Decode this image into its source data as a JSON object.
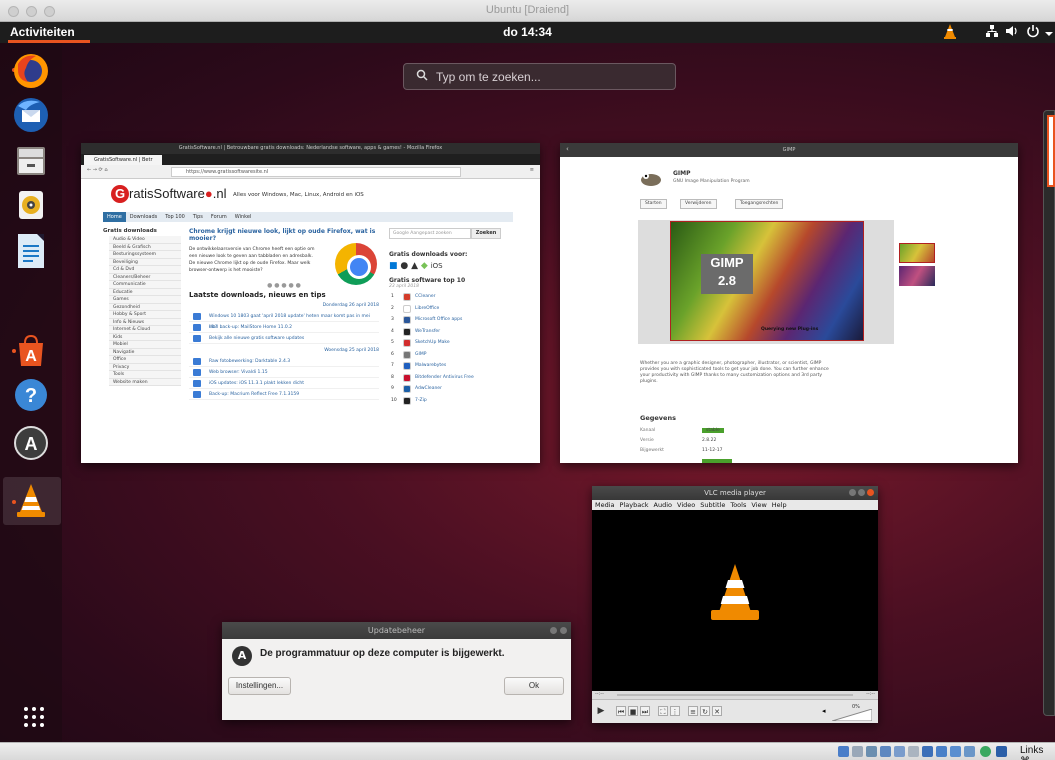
{
  "host": {
    "title": "Ubuntu [Draiend]",
    "status_text": "Links ⌘"
  },
  "topbar": {
    "activities": "Activiteiten",
    "clock": "do 14:34"
  },
  "search": {
    "placeholder": "Typ om te zoeken..."
  },
  "dock": {
    "items": [
      "firefox-icon",
      "thunderbird-icon",
      "files-icon",
      "rhythmbox-icon",
      "libreoffice-writer-icon",
      "ubuntu-software-icon",
      "help-icon",
      "software-updater-icon",
      "vlc-icon"
    ]
  },
  "firefox": {
    "window_title": "GratisSoftware.nl | Betrouwbare gratis downloads: Nederlandse software, apps & games! - Mozilla Firefox",
    "tab_label": "GratisSoftware.nl | Betr",
    "url": "https://www.gratissoftwaresite.nl",
    "logo_text": "ratisSoftware",
    "logo_suffix": ".nl",
    "tagline": "Alles voor Windows, Mac, Linux, Android en iOS",
    "menu": [
      "Home",
      "Downloads",
      "Top 100",
      "Tips",
      "Forum",
      "Winkel"
    ],
    "side_heading": "Gratis downloads",
    "side_items": [
      "Audio & Video",
      "Beeld & Grafisch",
      "Besturingssysteem",
      "Beveiliging",
      "Cd & Dvd",
      "Cleaners/Beheer",
      "Communicatie",
      "Educatie",
      "Games",
      "Gezondheid",
      "Hobby & Sport",
      "Info & Nieuws",
      "Internet & Cloud",
      "Kids",
      "Mobiel",
      "Navigatie",
      "Office",
      "Privacy",
      "Tools",
      "Website maken"
    ],
    "headline": "Chrome krijgt nieuwe look, lijkt op oude Firefox, wat is mooier?",
    "headline_body": "De ontwikkelaarsversie van Chrome heeft een optie om een nieuwe look te geven aan tabbladen en adresbalk. De nieuwe Chrome lijkt op de oude Firefox. Maar welk browser-ontwerp is het mooiste?",
    "latest_heading": "Laatste downloads, nieuws en tips",
    "date1": "Donderdag 26 april 2018",
    "news1": [
      "Windows 10 1803 gaat 'april 2018 update' heten maar komt pas in mei uit?",
      "Mail back-up: MailStore Home 11.0.2",
      "Bekijk alle nieuwe gratis software updates"
    ],
    "date2": "Woensdag 25 april 2018",
    "news2": [
      "Raw fotobewerking: Darktable 2.4.3",
      "Web browser: Vivaldi 1.15",
      "iOS updates: iOS 11.3.1 plakt lekken dicht",
      "Back-up: Macrium Reflect Free 7.1.3159"
    ],
    "search_placeholder": "Google Aangepast zoeken",
    "search_button": "Zoeken",
    "platforms_heading": "Gratis downloads voor:",
    "top_heading": "Gratis software top 10",
    "top_date": "23 april 2018",
    "top_items": [
      {
        "rank": "1",
        "name": "CCleaner",
        "color": "#d43c2a"
      },
      {
        "rank": "2",
        "name": "LibreOffice",
        "color": "#ffffff"
      },
      {
        "rank": "3",
        "name": "Microsoft Office apps",
        "color": "#2b579a"
      },
      {
        "rank": "4",
        "name": "WeTransfer",
        "color": "#222222"
      },
      {
        "rank": "5",
        "name": "SketchUp Make",
        "color": "#d22d2d"
      },
      {
        "rank": "6",
        "name": "GIMP",
        "color": "#777777"
      },
      {
        "rank": "7",
        "name": "Malwarebytes",
        "color": "#1f5fbf"
      },
      {
        "rank": "8",
        "name": "Bitdefender Antivirus Free",
        "color": "#c8102e"
      },
      {
        "rank": "9",
        "name": "AdwCleaner",
        "color": "#1a5fa8"
      },
      {
        "rank": "10",
        "name": "7-Zip",
        "color": "#222222"
      }
    ]
  },
  "gimp": {
    "window_title": "GIMP",
    "app_name": "GIMP",
    "app_sub": "GNU Image Manipulation Program",
    "buttons": [
      "Starten",
      "Verwijderen",
      "Toegangsrechten"
    ],
    "splash_label": "GIMP 2.8",
    "splash_caption": "Querying new Plug-ins",
    "description": "Whether you are a graphic designer, photographer, illustrator, or scientist, GIMP provides you with sophisticated tools to get your job done. You can further enhance your productivity with GIMP thanks to many customization options and 3rd party plugins.",
    "details_heading": "Gegevens",
    "details": [
      {
        "key": "Kanaal",
        "value": "stable"
      },
      {
        "key": "Versie",
        "value": "2.8.22"
      },
      {
        "key": "Bijgewerkt",
        "value": "11-12-17"
      }
    ]
  },
  "vlc": {
    "window_title": "VLC media player",
    "menu": [
      "Media",
      "Playback",
      "Audio",
      "Video",
      "Subtitle",
      "Tools",
      "View",
      "Help"
    ],
    "seek_left": "--:--",
    "seek_right": "--:--",
    "volume": "0%"
  },
  "update": {
    "window_title": "Updatebeheer",
    "message": "De programmatuur op deze computer is bijgewerkt.",
    "settings_button": "Instellingen...",
    "ok_button": "Ok"
  },
  "colors": {
    "ubuntu_orange": "#e95420",
    "topbar": "#1d1d1d",
    "gs_blue": "#2a63a0"
  }
}
